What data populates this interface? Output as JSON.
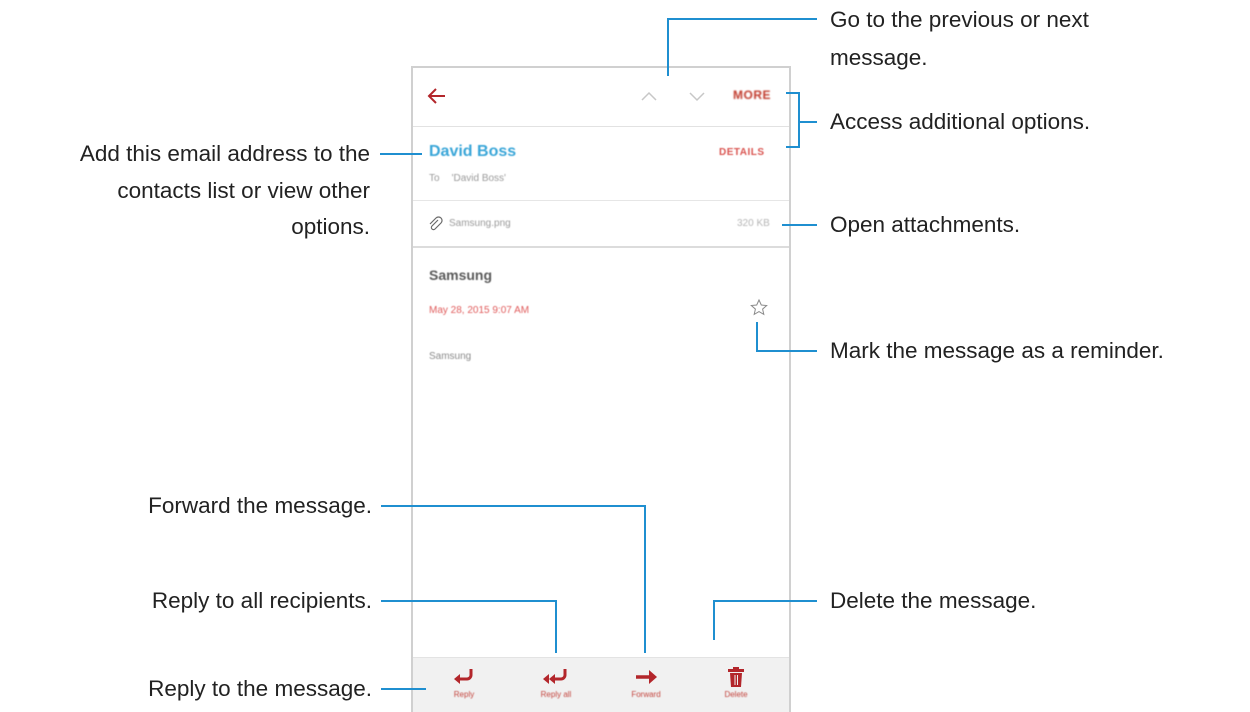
{
  "email": {
    "more_label": "MORE",
    "sender_name": "David Boss",
    "details_label": "DETAILS",
    "to_label": "To",
    "to_value": "'David Boss'",
    "attachment_name": "Samsung.png",
    "attachment_size": "320 KB",
    "subject": "Samsung",
    "date": "May 28, 2015  9:07 AM",
    "body": "Samsung"
  },
  "toolbar": {
    "reply_label": "Reply",
    "reply_all_label": "Reply all",
    "forward_label": "Forward",
    "delete_label": "Delete"
  },
  "callouts": {
    "prev_next_line1": "Go to the previous or next",
    "prev_next_line2": "message.",
    "more_options": "Access additional options.",
    "contact_line1": "Add this email address to the",
    "contact_line2": "contacts list or view other",
    "contact_line3": "options.",
    "attachments": "Open attachments.",
    "reminder": "Mark the message as a reminder.",
    "forward": "Forward the message.",
    "reply_all": "Reply to all recipients.",
    "delete": "Delete the message.",
    "reply": "Reply to the message."
  },
  "colors": {
    "accent": "#b3262b",
    "callout_line": "#1f8fd0",
    "sender": "#3aa6d8"
  }
}
